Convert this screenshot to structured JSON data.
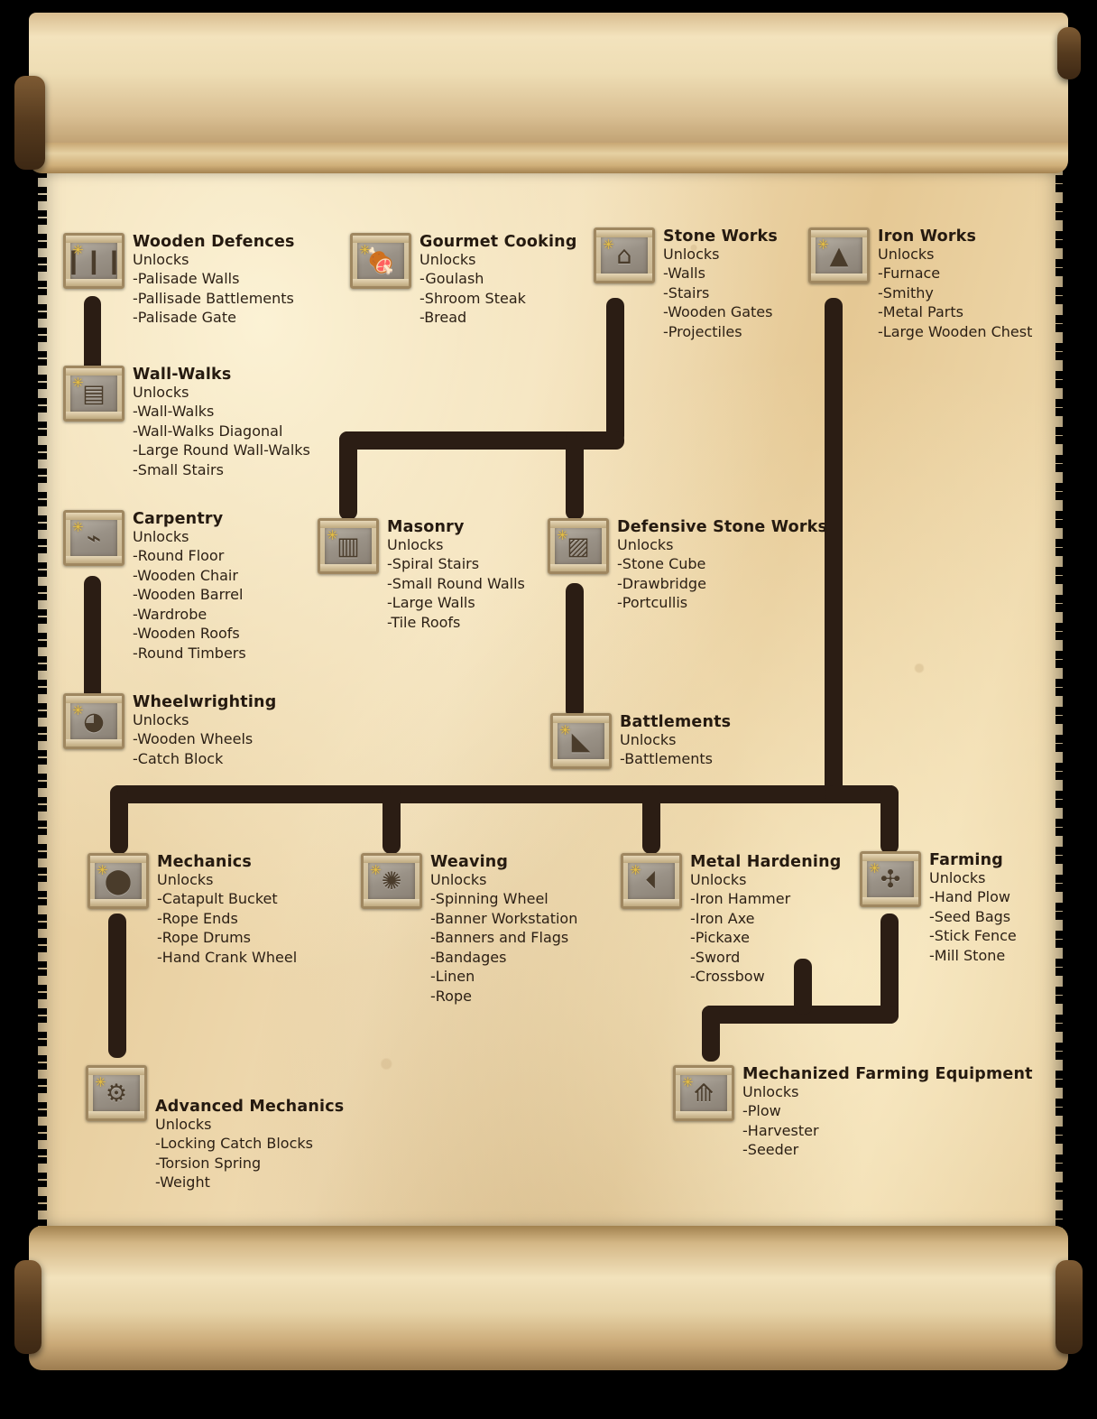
{
  "meta": {
    "unlocks_label": "Unlocks",
    "colors": {
      "link": "#2b1d14",
      "parchment": "#e8cfa0",
      "text": "#2b1f14",
      "star": "#e8c247"
    }
  },
  "nodes": [
    {
      "id": "wooden-defences",
      "title": "Wooden Defences",
      "icon": "palisade-stakes-icon",
      "glyph": "❙❙❙",
      "unlocks": [
        "Palisade Walls",
        "Pallisade Battlements",
        "Palisade Gate"
      ]
    },
    {
      "id": "gourmet-cooking",
      "title": "Gourmet Cooking",
      "icon": "cooked-meat-icon",
      "glyph": "🍖",
      "unlocks": [
        "Goulash",
        "Shroom Steak",
        "Bread"
      ]
    },
    {
      "id": "stone-works",
      "title": "Stone Works",
      "icon": "stone-archway-icon",
      "glyph": "⌂",
      "unlocks": [
        "Walls",
        "Stairs",
        "Wooden Gates",
        "Projectiles"
      ]
    },
    {
      "id": "iron-works",
      "title": "Iron Works",
      "icon": "furnace-icon",
      "glyph": "▲",
      "unlocks": [
        "Furnace",
        "Smithy",
        "Metal Parts",
        "Large Wooden Chest"
      ]
    },
    {
      "id": "wall-walks",
      "title": "Wall-Walks",
      "icon": "wall-walk-icon",
      "glyph": "▤",
      "unlocks": [
        "Wall-Walks",
        "Wall-Walks Diagonal",
        "Large Round Wall-Walks",
        "Small Stairs"
      ]
    },
    {
      "id": "carpentry",
      "title": "Carpentry",
      "icon": "saw-bench-icon",
      "glyph": "⌁",
      "unlocks": [
        "Round Floor",
        "Wooden Chair",
        "Wooden Barrel",
        "Wardrobe",
        "Wooden Roofs",
        "Round Timbers"
      ]
    },
    {
      "id": "masonry",
      "title": "Masonry",
      "icon": "stone-blocks-icon",
      "glyph": "▥",
      "unlocks": [
        "Spiral Stairs",
        "Small Round Walls",
        "Large Walls",
        "Tile Roofs"
      ]
    },
    {
      "id": "defensive-stone-works",
      "title": "Defensive Stone Works",
      "icon": "stone-cube-icon",
      "glyph": "▨",
      "unlocks": [
        "Stone Cube",
        "Drawbridge",
        "Portcullis"
      ]
    },
    {
      "id": "wheelwrighting",
      "title": "Wheelwrighting",
      "icon": "wooden-wheel-icon",
      "glyph": "◕",
      "unlocks": [
        "Wooden Wheels",
        "Catch Block"
      ]
    },
    {
      "id": "battlements",
      "title": "Battlements",
      "icon": "battlement-icon",
      "glyph": "◣",
      "unlocks": [
        "Battlements"
      ]
    },
    {
      "id": "mechanics",
      "title": "Mechanics",
      "icon": "rope-drum-icon",
      "glyph": "⬤",
      "unlocks": [
        "Catapult Bucket",
        "Rope Ends",
        "Rope Drums",
        "Hand Crank Wheel"
      ]
    },
    {
      "id": "weaving",
      "title": "Weaving",
      "icon": "spinning-wheel-icon",
      "glyph": "✺",
      "unlocks": [
        "Spinning Wheel",
        "Banner Workstation",
        "Banners and Flags",
        "Bandages",
        "Linen",
        "Rope"
      ]
    },
    {
      "id": "metal-hardening",
      "title": "Metal Hardening",
      "icon": "anvil-icon",
      "glyph": "⏴",
      "unlocks": [
        "Iron Hammer",
        "Iron Axe",
        "Pickaxe",
        "Sword",
        "Crossbow"
      ]
    },
    {
      "id": "farming",
      "title": "Farming",
      "icon": "hand-plow-icon",
      "glyph": "✣",
      "unlocks": [
        "Hand Plow",
        "Seed Bags",
        "Stick Fence",
        "Mill Stone"
      ]
    },
    {
      "id": "advanced-mechanics",
      "title": "Advanced Mechanics",
      "icon": "torsion-spring-icon",
      "glyph": "⚙",
      "unlocks": [
        "Locking Catch Blocks",
        "Torsion Spring",
        "Weight"
      ]
    },
    {
      "id": "mechanized-farming-equipment",
      "title": "Mechanized Farming Equipment",
      "icon": "harvester-icon",
      "glyph": "⟰",
      "unlocks": [
        "Plow",
        "Harvester",
        "Seeder"
      ]
    }
  ],
  "connections": [
    {
      "from": "wooden-defences",
      "to": "wall-walks"
    },
    {
      "from": "carpentry",
      "to": "wheelwrighting"
    },
    {
      "from": "stone-works",
      "to": "masonry"
    },
    {
      "from": "stone-works",
      "to": "defensive-stone-works"
    },
    {
      "from": "defensive-stone-works",
      "to": "battlements"
    },
    {
      "from": "iron-works",
      "to": "mechanics"
    },
    {
      "from": "iron-works",
      "to": "weaving"
    },
    {
      "from": "iron-works",
      "to": "metal-hardening"
    },
    {
      "from": "iron-works",
      "to": "farming"
    },
    {
      "from": "mechanics",
      "to": "advanced-mechanics"
    },
    {
      "from": "farming",
      "to": "mechanized-farming-equipment"
    },
    {
      "from": "metal-hardening",
      "to": "mechanized-farming-equipment"
    }
  ]
}
